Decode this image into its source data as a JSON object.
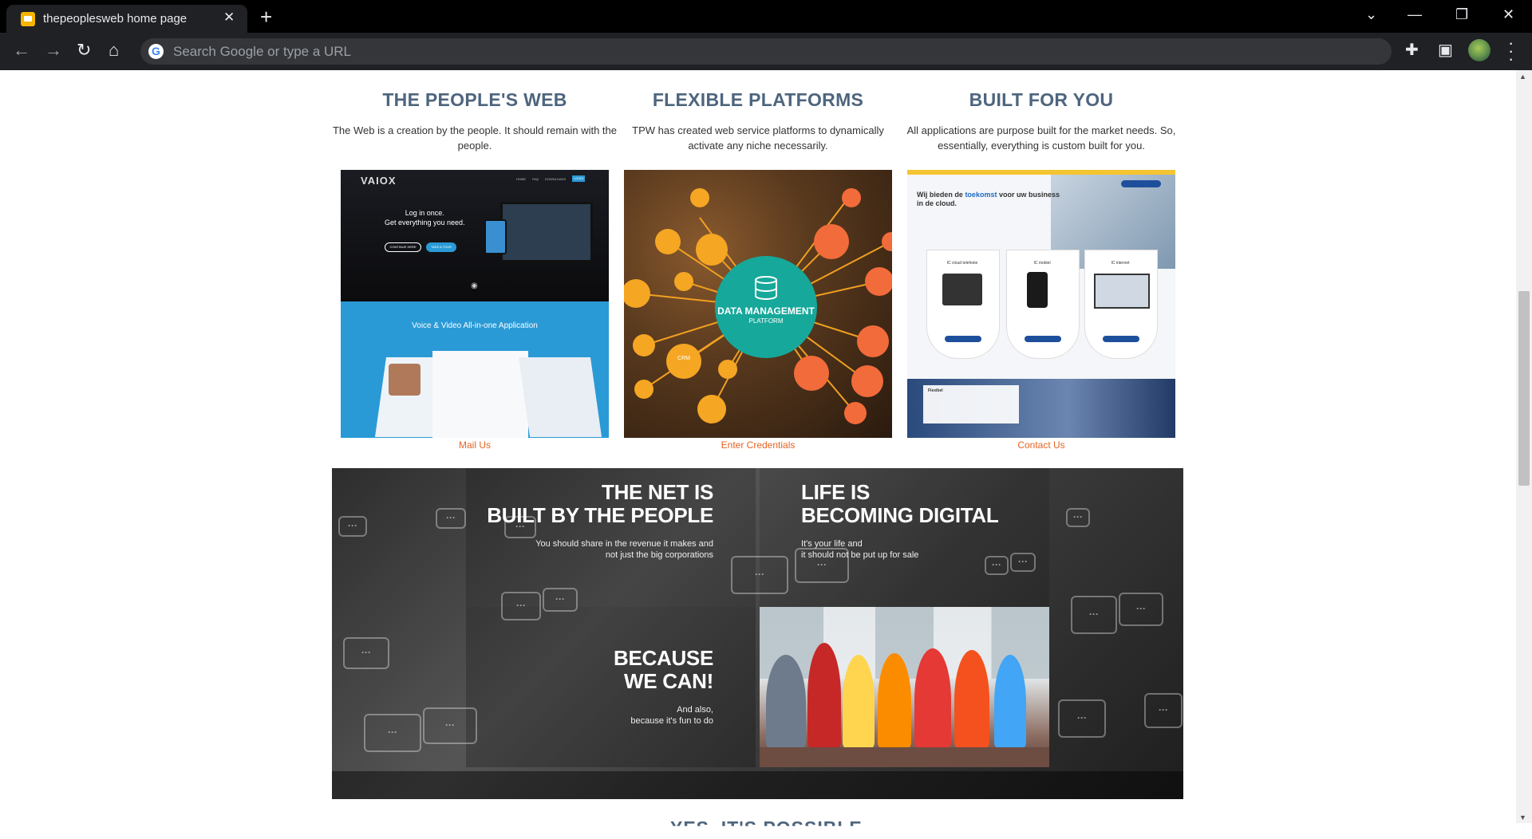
{
  "browser": {
    "tab_title": "thepeoplesweb home page",
    "tab_close": "✕",
    "new_tab": "+",
    "omnibox_placeholder": "Search Google or type a URL",
    "window_controls": {
      "dropdown": "⌄",
      "minimize": "—",
      "restore": "❐",
      "close": "✕"
    }
  },
  "features": [
    {
      "title": "THE PEOPLE'S WEB",
      "text": "The Web is a creation by the people. It should remain with the people.",
      "link": "Mail Us"
    },
    {
      "title": "FLEXIBLE PLATFORMS",
      "text": "TPW has created web service platforms to dynamically activate any niche necessarily.",
      "link": "Enter Credentials"
    },
    {
      "title": "BUILT FOR YOU",
      "text": "All applications are purpose built for the market needs. So, essentially, everything is custom built for you.",
      "link": "Contact Us"
    }
  ],
  "thumb1": {
    "brand": "VAIOX",
    "nav": [
      "HOME",
      "FAQ",
      "DOWNLOADS",
      "LOGIN"
    ],
    "headline": "Log in once.\nGet everything you need.",
    "cta1": "CONTINUE HERE",
    "cta2": "TAKE A TOUR",
    "section_title": "Voice & Video All-in-one Application"
  },
  "thumb2": {
    "center_title": "DATA MANAGEMENT",
    "center_sub": "PLATFORM",
    "node_label": "CRM"
  },
  "thumb3": {
    "headline_a": "Wij bieden de ",
    "headline_highlight": "toekomst",
    "headline_b": " voor uw business in de cloud.",
    "cards": [
      "IC cloud telefonie",
      "IC mobiel",
      "IC internet"
    ],
    "lower_label": "Flexibel"
  },
  "banner": {
    "block1_title": "THE NET IS\nBUILT BY THE PEOPLE",
    "block1_sub": "You should share in the revenue it makes and\nnot just the big corporations",
    "block2_title": "LIFE IS\nBECOMING DIGITAL",
    "block2_sub": "It's your life and\nit should not be put up for sale",
    "block3_title": "BECAUSE\nWE CAN!",
    "block3_sub": "And also,\nbecause it's fun to do"
  },
  "below_heading": "YES, IT'S POSSIBLE"
}
